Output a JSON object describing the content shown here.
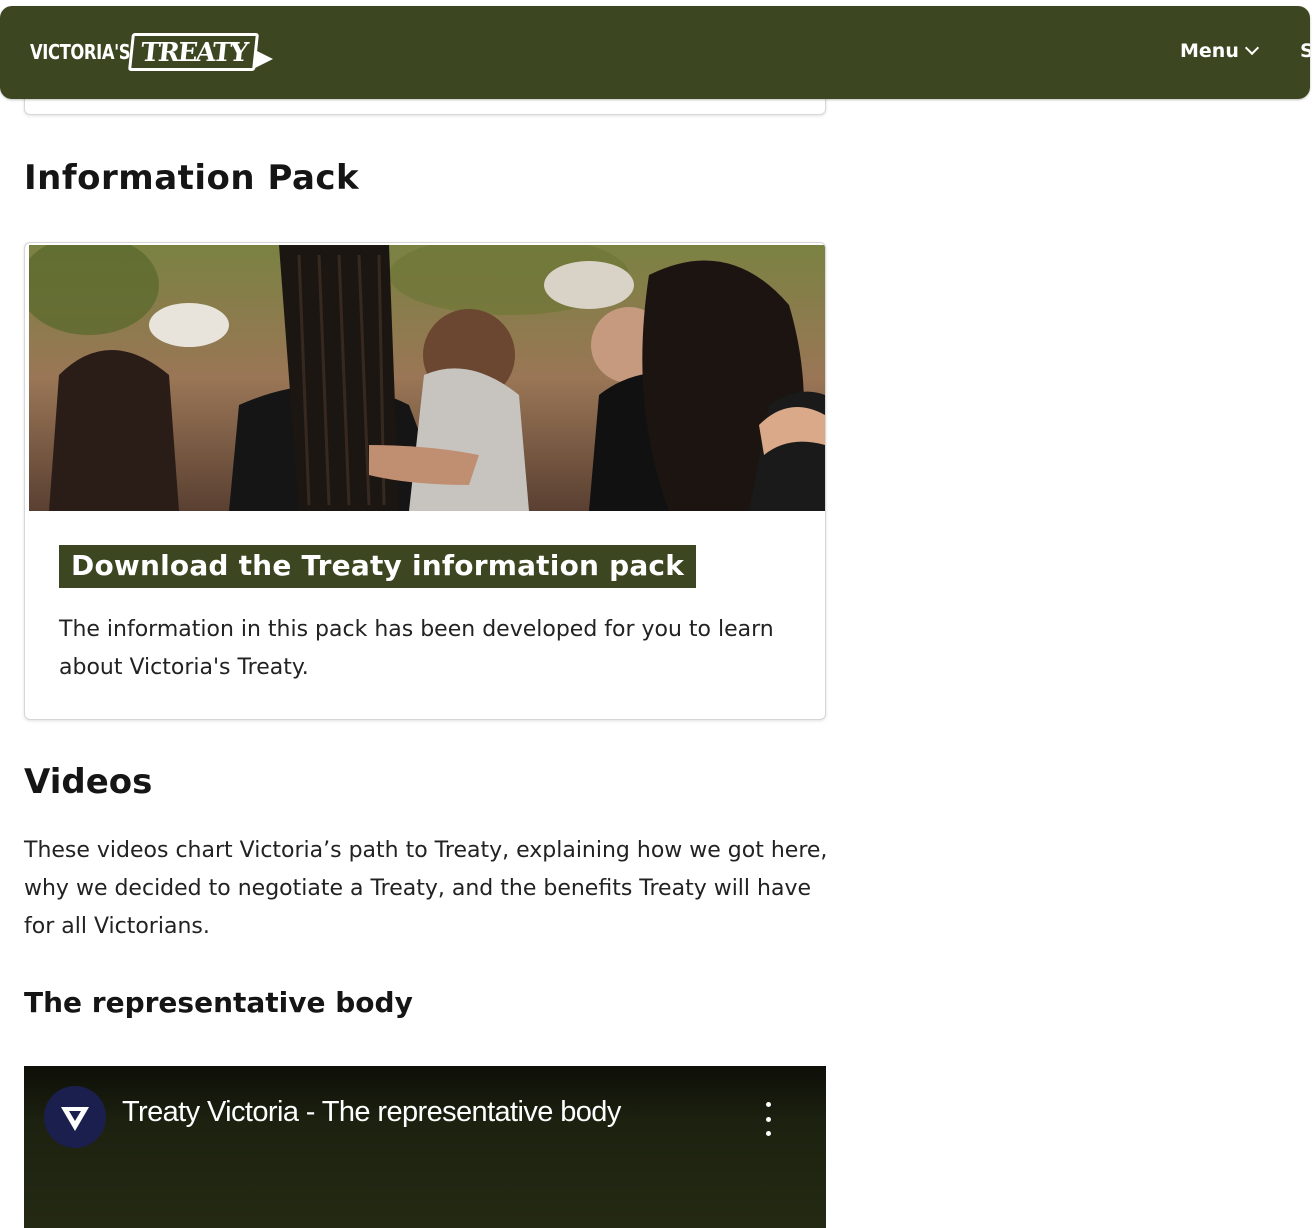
{
  "header": {
    "logo_small": "VICTORIA'S",
    "logo_big": "TREATY",
    "menu_label": "Menu",
    "search_label": "S",
    "background_color": "#3c4620"
  },
  "info_pack": {
    "heading": "Information Pack",
    "card": {
      "image_description": "crowd-photo",
      "title": "Download the Treaty information pack",
      "description": "The information in this pack has been developed for you to learn about Victoria's Treaty."
    }
  },
  "videos": {
    "heading": "Videos",
    "description": "These videos chart Victoria’s path to Treaty, explaining how we got here, why we decided to negotiate a Treaty, and the benefits Treaty will have for all Victorians.",
    "subheading": "The representative body",
    "embed": {
      "title": "Treaty Victoria - The representative body",
      "channel_icon": "vic-logo-icon",
      "menu_icon": "kebab-menu-icon"
    }
  }
}
